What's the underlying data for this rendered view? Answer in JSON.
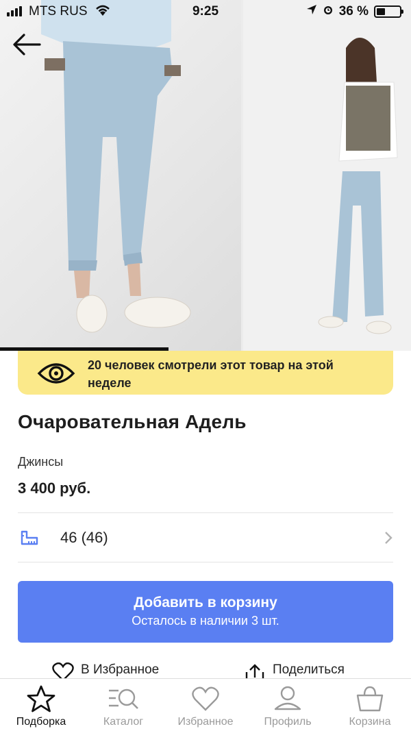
{
  "status_bar": {
    "carrier": "MTS RUS",
    "time": "9:25",
    "battery_percent": "36 %",
    "battery_level": 0.36
  },
  "gallery": {
    "progress": 0.41
  },
  "notice": {
    "text": "20 человек смотрели этот товар на этой неделе"
  },
  "product": {
    "title": "Очаровательная Адель",
    "category": "Джинсы",
    "price": "3 400 руб.",
    "size": "46 (46)"
  },
  "cart_button": {
    "label": "Добавить в корзину",
    "stock": "Осталось в наличии 3 шт."
  },
  "actions": {
    "favorite": "В Избранное",
    "share": "Поделиться"
  },
  "tabs": [
    {
      "label": "Подборка",
      "icon": "star-icon",
      "active": true
    },
    {
      "label": "Каталог",
      "icon": "catalog-icon",
      "active": false
    },
    {
      "label": "Избранное",
      "icon": "heart-icon",
      "active": false
    },
    {
      "label": "Профиль",
      "icon": "profile-icon",
      "active": false
    },
    {
      "label": "Корзина",
      "icon": "basket-icon",
      "active": false
    }
  ],
  "colors": {
    "accent": "#5a7ff2",
    "notice_bg": "#fbe98a",
    "ruler_icon": "#5a7ff2"
  }
}
